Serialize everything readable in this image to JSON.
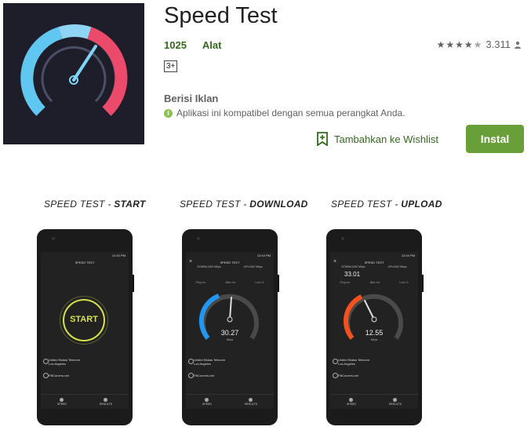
{
  "app": {
    "title": "Speed Test",
    "developer": "1025",
    "category": "Alat",
    "age_rating": "3+",
    "rating_count": "3.311",
    "rating_stars": 4.5,
    "ads_label": "Berisi Iklan",
    "compat_text": "Aplikasi ini kompatibel dengan semua perangkat Anda.",
    "wishlist_label": "Tambahkan ke Wishlist",
    "install_label": "Instal",
    "accent_color": "#689f38"
  },
  "screenshots": [
    {
      "caption_prefix": "SPEED TEST - ",
      "caption_emph": "START",
      "status_time": "12:43 PM",
      "screen_title": "SPEED TEST",
      "start_label": "START",
      "isp_name": "United Status Telecom",
      "isp_location": "Los Angeles",
      "server": "FBCorvers.net",
      "tab_speed": "SPEED",
      "tab_results": "RESULTS"
    },
    {
      "caption_prefix": "SPEED TEST - ",
      "caption_emph": "DOWNLOAD",
      "status_time": "12:44 PM",
      "screen_title": "SPEED TEST",
      "download_label": "DOWNLOAD Mbps",
      "upload_label": "UPLOAD Mbps",
      "ping_label": "Ping ms",
      "jitter_label": "Jitter ms",
      "loss_label": "Loss %",
      "gauge_value": "30.27",
      "gauge_unit": "Mbps",
      "gauge_color": "#2196f3",
      "isp_name": "United Status Telecom",
      "isp_location": "Los Angeles",
      "server": "FBCorvers.net",
      "tab_speed": "SPEED",
      "tab_results": "RESULTS"
    },
    {
      "caption_prefix": "SPEED TEST - ",
      "caption_emph": "UPLOAD",
      "status_time": "12:44 PM",
      "screen_title": "SPEED TEST",
      "download_label": "DOWNLOAD Mbps",
      "download_value": "33.01",
      "upload_label": "UPLOAD Mbps",
      "ping_label": "Ping ms",
      "jitter_label": "Jitter ms",
      "loss_label": "Loss %",
      "gauge_value": "12.55",
      "gauge_unit": "Mbps",
      "gauge_color": "#f4511e",
      "isp_name": "United Status Telecom",
      "isp_location": "Los Angeles",
      "server": "FBCorvers.net",
      "tab_speed": "SPEED",
      "tab_results": "RESULTS"
    }
  ]
}
